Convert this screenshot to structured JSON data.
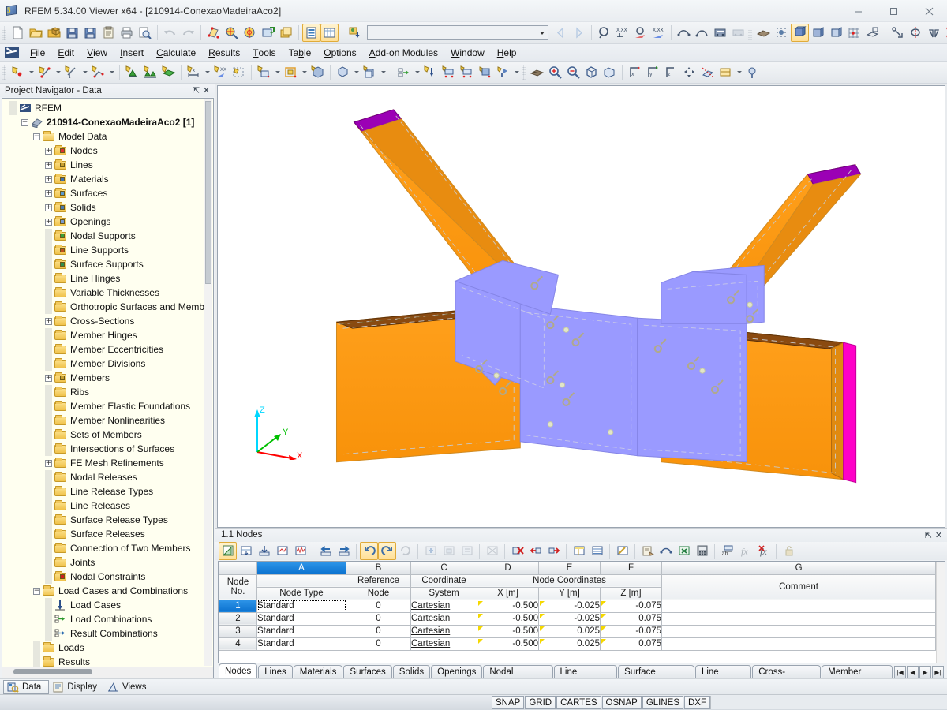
{
  "window": {
    "title": "RFEM 5.34.00 Viewer x64 - [210914-ConexaoMadeiraAco2]",
    "minimize": "minimize-button",
    "maximize": "maximize-button",
    "close": "close-button"
  },
  "menubar": {
    "items": [
      {
        "label": "File",
        "mnemonic": "F"
      },
      {
        "label": "Edit",
        "mnemonic": "E"
      },
      {
        "label": "View",
        "mnemonic": "V"
      },
      {
        "label": "Insert",
        "mnemonic": "I"
      },
      {
        "label": "Calculate",
        "mnemonic": "C"
      },
      {
        "label": "Results",
        "mnemonic": "R"
      },
      {
        "label": "Tools",
        "mnemonic": "T"
      },
      {
        "label": "Table",
        "mnemonic": "b"
      },
      {
        "label": "Options",
        "mnemonic": "O"
      },
      {
        "label": "Add-on Modules",
        "mnemonic": "A"
      },
      {
        "label": "Window",
        "mnemonic": "W"
      },
      {
        "label": "Help",
        "mnemonic": "H"
      }
    ]
  },
  "toolbar_main": {
    "combo_value": "",
    "groups": [
      [
        "new-file-icon",
        "open-file-icon",
        "open-package-icon",
        "save-package-icon",
        "save-icon",
        "clipboard-icon",
        "print-icon",
        "print-preview-icon"
      ],
      [
        "undo-icon",
        "redo-icon"
      ],
      [
        "render-model-icon",
        "zoom-select-icon",
        "rotate-view-icon",
        "add-selection-icon",
        "window-icon"
      ],
      [
        "display-properties-icon",
        "table-display-icon"
      ],
      [
        "load-case-icon"
      ]
    ]
  },
  "toolbar_secondary": {
    "groups": [
      [
        "new-node-icon",
        "new-line-icon",
        "new-dimension-icon",
        "new-polyline-icon"
      ],
      [
        "new-nodal-support-icon",
        "new-line-support-icon",
        "new-surface-support-icon"
      ],
      [
        "new-member-hinge-icon",
        "new-nodal-load-icon",
        "new-selection-icon"
      ],
      [
        "new-surface-icon",
        "new-opening-icon",
        "new-solid-icon"
      ],
      [
        "new-member-icon",
        "new-member-set-icon"
      ],
      [
        "new-load-case-icon",
        "new-free-load-icon",
        "new-line-load-icon",
        "new-surface-load-icon",
        "new-imposed-load-icon"
      ],
      [
        "mesh-icon",
        "zoom-in-icon",
        "zoom-out-icon",
        "isometric-view-icon",
        "perspective-view-icon"
      ],
      [
        "view-xz-icon",
        "view-yz-icon"
      ]
    ]
  },
  "navigator": {
    "title": "Project Navigator - Data",
    "pin_icon": "pin-icon",
    "close_icon": "close-icon",
    "tree": [
      {
        "label": "RFEM",
        "depth": 0,
        "expander": "none",
        "icon": "rfem-logo-icon",
        "bold": false
      },
      {
        "label": "210914-ConexaoMadeiraAco2 [1]",
        "depth": 1,
        "expander": "minus",
        "icon": "model-icon",
        "bold": true
      },
      {
        "label": "Model Data",
        "depth": 2,
        "expander": "minus",
        "icon": "folder-open-icon",
        "bold": false
      },
      {
        "label": "Nodes",
        "depth": 3,
        "expander": "plus",
        "icon": "nodes-icon",
        "bold": false
      },
      {
        "label": "Lines",
        "depth": 3,
        "expander": "plus",
        "icon": "lines-icon",
        "bold": false
      },
      {
        "label": "Materials",
        "depth": 3,
        "expander": "plus",
        "icon": "materials-icon",
        "bold": false
      },
      {
        "label": "Surfaces",
        "depth": 3,
        "expander": "plus",
        "icon": "surfaces-icon",
        "bold": false
      },
      {
        "label": "Solids",
        "depth": 3,
        "expander": "plus",
        "icon": "solids-icon",
        "bold": false
      },
      {
        "label": "Openings",
        "depth": 3,
        "expander": "plus",
        "icon": "openings-icon",
        "bold": false
      },
      {
        "label": "Nodal Supports",
        "depth": 3,
        "expander": "none",
        "icon": "nodal-supports-icon",
        "bold": false
      },
      {
        "label": "Line Supports",
        "depth": 3,
        "expander": "none",
        "icon": "line-supports-icon",
        "bold": false
      },
      {
        "label": "Surface Supports",
        "depth": 3,
        "expander": "none",
        "icon": "surface-supports-icon",
        "bold": false
      },
      {
        "label": "Line Hinges",
        "depth": 3,
        "expander": "none",
        "icon": "line-hinges-icon",
        "bold": false
      },
      {
        "label": "Variable Thicknesses",
        "depth": 3,
        "expander": "none",
        "icon": "variable-thicknesses-icon",
        "bold": false
      },
      {
        "label": "Orthotropic Surfaces and Memb",
        "depth": 3,
        "expander": "none",
        "icon": "orthotropic-surfaces-icon",
        "bold": false
      },
      {
        "label": "Cross-Sections",
        "depth": 3,
        "expander": "plus",
        "icon": "cross-sections-icon",
        "bold": false
      },
      {
        "label": "Member Hinges",
        "depth": 3,
        "expander": "none",
        "icon": "member-hinges-icon",
        "bold": false
      },
      {
        "label": "Member Eccentricities",
        "depth": 3,
        "expander": "none",
        "icon": "member-eccentricities-icon",
        "bold": false
      },
      {
        "label": "Member Divisions",
        "depth": 3,
        "expander": "none",
        "icon": "member-divisions-icon",
        "bold": false
      },
      {
        "label": "Members",
        "depth": 3,
        "expander": "plus",
        "icon": "members-icon",
        "bold": false
      },
      {
        "label": "Ribs",
        "depth": 3,
        "expander": "none",
        "icon": "ribs-icon",
        "bold": false
      },
      {
        "label": "Member Elastic Foundations",
        "depth": 3,
        "expander": "none",
        "icon": "member-elastic-foundations-icon",
        "bold": false
      },
      {
        "label": "Member Nonlinearities",
        "depth": 3,
        "expander": "none",
        "icon": "member-nonlinearities-icon",
        "bold": false
      },
      {
        "label": "Sets of Members",
        "depth": 3,
        "expander": "none",
        "icon": "sets-of-members-icon",
        "bold": false
      },
      {
        "label": "Intersections of Surfaces",
        "depth": 3,
        "expander": "none",
        "icon": "intersections-icon",
        "bold": false
      },
      {
        "label": "FE Mesh Refinements",
        "depth": 3,
        "expander": "plus",
        "icon": "fe-mesh-refinements-icon",
        "bold": false
      },
      {
        "label": "Nodal Releases",
        "depth": 3,
        "expander": "none",
        "icon": "nodal-releases-icon",
        "bold": false
      },
      {
        "label": "Line Release Types",
        "depth": 3,
        "expander": "none",
        "icon": "line-release-types-icon",
        "bold": false
      },
      {
        "label": "Line Releases",
        "depth": 3,
        "expander": "none",
        "icon": "line-releases-icon",
        "bold": false
      },
      {
        "label": "Surface Release Types",
        "depth": 3,
        "expander": "none",
        "icon": "surface-release-types-icon",
        "bold": false
      },
      {
        "label": "Surface Releases",
        "depth": 3,
        "expander": "none",
        "icon": "surface-releases-icon",
        "bold": false
      },
      {
        "label": "Connection of Two Members",
        "depth": 3,
        "expander": "none",
        "icon": "connection-two-members-icon",
        "bold": false
      },
      {
        "label": "Joints",
        "depth": 3,
        "expander": "none",
        "icon": "joints-icon",
        "bold": false
      },
      {
        "label": "Nodal Constraints",
        "depth": 3,
        "expander": "none",
        "icon": "nodal-constraints-icon",
        "bold": false
      },
      {
        "label": "Load Cases and Combinations",
        "depth": 2,
        "expander": "minus",
        "icon": "folder-open-icon",
        "bold": false
      },
      {
        "label": "Load Cases",
        "depth": 3,
        "expander": "none",
        "icon": "load-cases-icon",
        "bold": false
      },
      {
        "label": "Load Combinations",
        "depth": 3,
        "expander": "none",
        "icon": "load-combinations-icon",
        "bold": false
      },
      {
        "label": "Result Combinations",
        "depth": 3,
        "expander": "none",
        "icon": "result-combinations-icon",
        "bold": false
      },
      {
        "label": "Loads",
        "depth": 2,
        "expander": "none",
        "icon": "folder-icon",
        "bold": false
      },
      {
        "label": "Results",
        "depth": 2,
        "expander": "none",
        "icon": "folder-icon",
        "bold": false
      }
    ]
  },
  "view3d": {
    "axes": {
      "x_label": "X",
      "y_label": "Y",
      "z_label": "Z",
      "x_color": "#ff0000",
      "y_color": "#00c000",
      "z_color": "#00d7ff"
    },
    "colors": {
      "timber": "#ff9a12",
      "timber_dark": "#8a4a10",
      "steel_plate": "#9a9aff",
      "end_magenta": "#ff00c8",
      "end_purple": "#9b00b5",
      "outline": "#b0b0b0",
      "background": "#ffffff"
    }
  },
  "table_panel": {
    "title": "1.1 Nodes",
    "pin_icon": "pin-icon",
    "close_icon": "close-icon",
    "toolbar": [
      "edit-table-icon",
      "insert-row-icon",
      "import-icon",
      "chart-icon",
      "diagram-icon",
      "prev-table-icon",
      "next-table-icon",
      "undo-icon",
      "redo-icon",
      "refresh-icon",
      "add-row-icon",
      "copy-row-icon",
      "sort-icon",
      "clear-icon",
      "delete-all-icon",
      "delete-row-icon",
      "insert-after-icon",
      "color-columns-icon",
      "grid-view-icon",
      "filter-icon",
      "edit-pen-icon",
      "report-icon",
      "view-selection-icon",
      "excel-export-icon",
      "calculator-icon",
      "units-icon",
      "fx-icon",
      "clear-fx-icon",
      "lock-icon"
    ],
    "columns": [
      {
        "letter": "A",
        "selected": true
      },
      {
        "letter": "B",
        "selected": false
      },
      {
        "letter": "C",
        "selected": false
      },
      {
        "letter": "D",
        "selected": false
      },
      {
        "letter": "E",
        "selected": false
      },
      {
        "letter": "F",
        "selected": false
      },
      {
        "letter": "G",
        "selected": false
      }
    ],
    "group_header": {
      "label": "Node Coordinates",
      "span": 3
    },
    "headers": {
      "row_no_top": "Node",
      "row_no_bottom": "No.",
      "a_top": "",
      "a_bottom": "Node Type",
      "b_top": "Reference",
      "b_bottom": "Node",
      "c_top": "Coordinate",
      "c_bottom": "System",
      "d_bottom": "X [m]",
      "e_bottom": "Y [m]",
      "f_bottom": "Z [m]",
      "g_bottom": "Comment"
    },
    "rows": [
      {
        "no": "1",
        "node_type": "Standard",
        "reference_node": "0",
        "coordinate_system": "Cartesian",
        "x": "-0.500",
        "y": "-0.025",
        "z": "-0.075",
        "comment": "",
        "selected": true
      },
      {
        "no": "2",
        "node_type": "Standard",
        "reference_node": "0",
        "coordinate_system": "Cartesian",
        "x": "-0.500",
        "y": "-0.025",
        "z": "0.075",
        "comment": "",
        "selected": false
      },
      {
        "no": "3",
        "node_type": "Standard",
        "reference_node": "0",
        "coordinate_system": "Cartesian",
        "x": "-0.500",
        "y": "0.025",
        "z": "-0.075",
        "comment": "",
        "selected": false
      },
      {
        "no": "4",
        "node_type": "Standard",
        "reference_node": "0",
        "coordinate_system": "Cartesian",
        "x": "-0.500",
        "y": "0.025",
        "z": "0.075",
        "comment": "",
        "selected": false
      }
    ],
    "tabs": [
      {
        "label": "Nodes",
        "active": true
      },
      {
        "label": "Lines",
        "active": false
      },
      {
        "label": "Materials",
        "active": false
      },
      {
        "label": "Surfaces",
        "active": false
      },
      {
        "label": "Solids",
        "active": false
      },
      {
        "label": "Openings",
        "active": false
      },
      {
        "label": "Nodal Supports",
        "active": false
      },
      {
        "label": "Line Supports",
        "active": false
      },
      {
        "label": "Surface Supports",
        "active": false
      },
      {
        "label": "Line Hinges",
        "active": false
      },
      {
        "label": "Cross-Sections",
        "active": false
      },
      {
        "label": "Member Hinges",
        "active": false
      }
    ],
    "nav_buttons": [
      "first-tab-button",
      "prev-tab-button",
      "next-tab-button",
      "last-tab-button"
    ]
  },
  "bottom_bar": {
    "items": [
      {
        "label": "Data",
        "icon": "data-icon",
        "active": true
      },
      {
        "label": "Display",
        "icon": "display-icon",
        "active": false
      },
      {
        "label": "Views",
        "icon": "views-icon",
        "active": false
      }
    ]
  },
  "status_bar": {
    "cells": [
      "SNAP",
      "GRID",
      "CARTES",
      "OSNAP",
      "GLINES",
      "DXF"
    ]
  }
}
